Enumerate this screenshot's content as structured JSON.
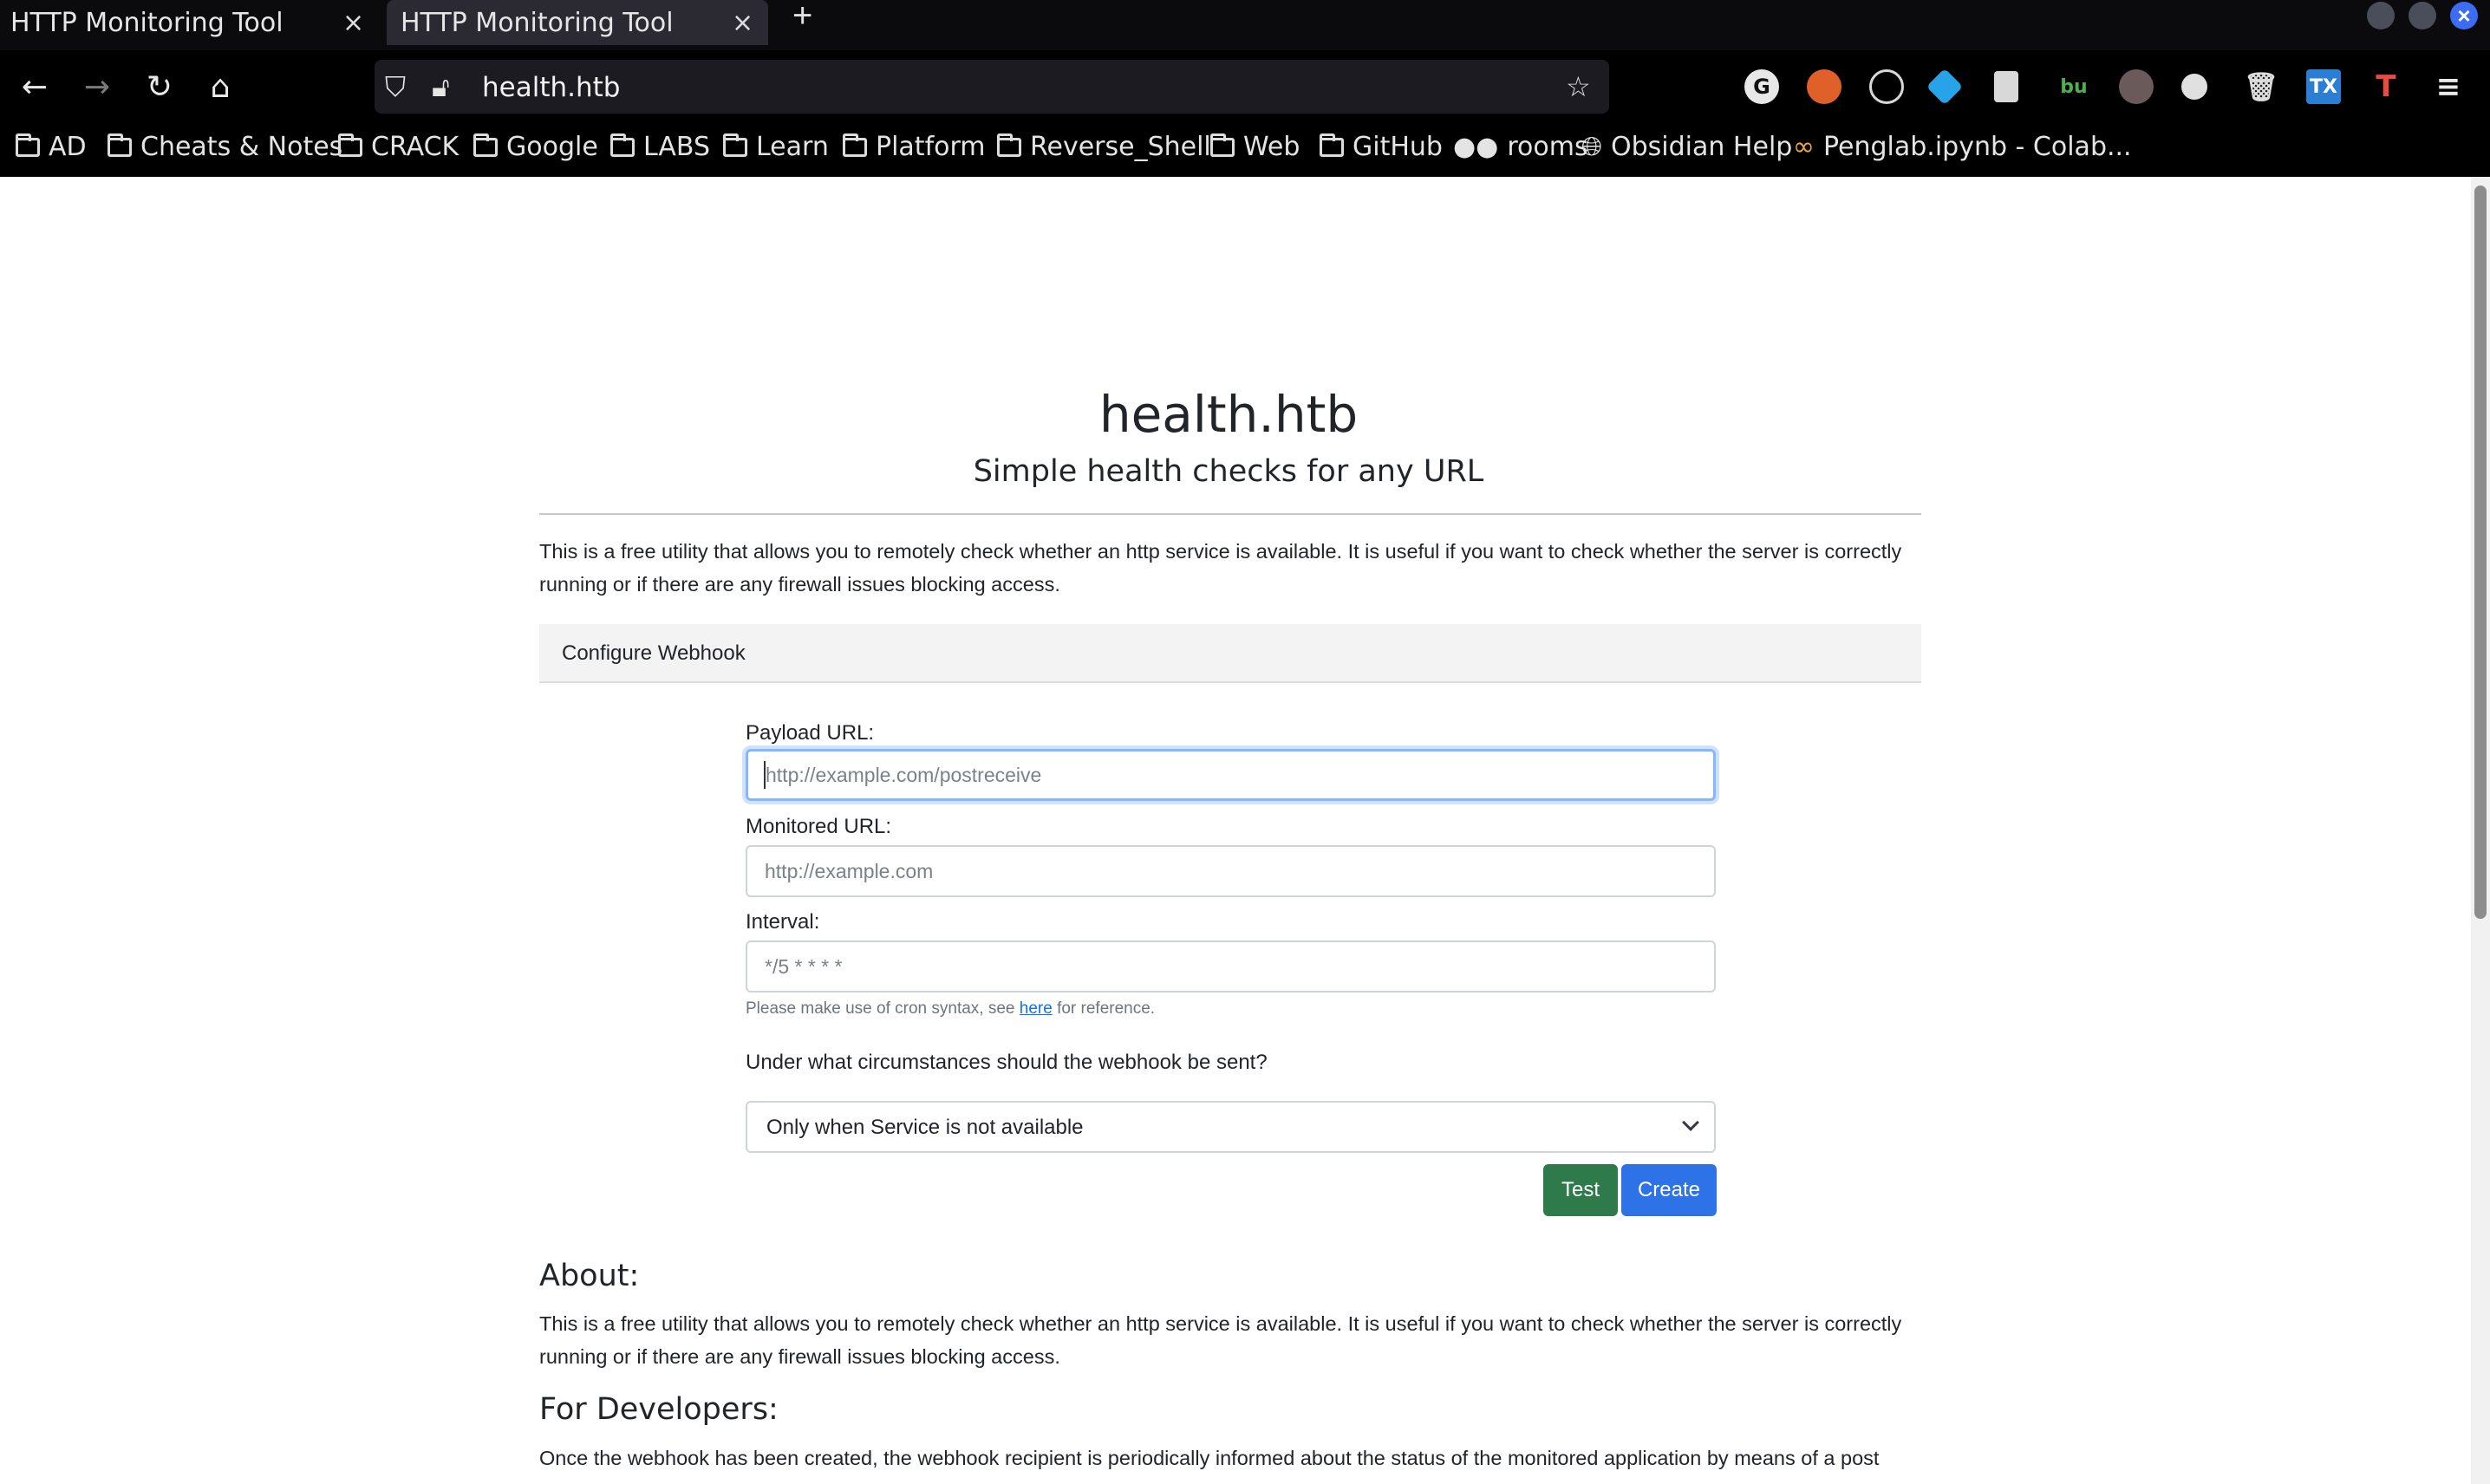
{
  "browser": {
    "tabs": [
      {
        "title": "HTTP Monitoring Tool",
        "close": "×"
      },
      {
        "title": "HTTP Monitoring Tool",
        "close": "×"
      }
    ],
    "new_tab": "+",
    "url": "health.htb",
    "bookmarks": [
      "AD",
      "Cheats & Notes",
      "CRACK",
      "Google",
      "LABS",
      "Learn",
      "Platform",
      "Reverse_Shell",
      "Web",
      "GitHub",
      "rooms",
      "Obsidian Help",
      "Penglab.ipynb - Colab..."
    ],
    "extensions": [
      "G",
      "",
      "",
      "",
      "",
      "bu",
      "",
      "",
      "",
      "TX",
      "T"
    ]
  },
  "page": {
    "title": "health.htb",
    "subtitle": "Simple health checks for any URL",
    "intro": "This is a free utility that allows you to remotely check whether an http service is available. It is useful if you want to check whether the server is correctly running or if there are any firewall issues blocking access.",
    "card_header": "Configure Webhook",
    "form": {
      "payload_label": "Payload URL:",
      "payload_placeholder": "http://example.com/postreceive",
      "monitored_label": "Monitored URL:",
      "monitored_placeholder": "http://example.com",
      "interval_label": "Interval:",
      "interval_placeholder": "*/5 * * * *",
      "help_prefix": "Please make use of cron syntax, see ",
      "help_link": "here",
      "help_suffix": " for reference.",
      "question": "Under what circumstances should the webhook be sent?",
      "select_value": "Only when Service is not available",
      "test_button": "Test",
      "create_button": "Create"
    },
    "about_heading": "About:",
    "about_text": "This is a free utility that allows you to remotely check whether an http service is available. It is useful if you want to check whether the server is correctly running or if there are any firewall issues blocking access.",
    "dev_heading": "For Developers:",
    "dev_text": "Once the webhook has been created, the webhook recipient is periodically informed about the status of the monitored application by means of a post"
  }
}
